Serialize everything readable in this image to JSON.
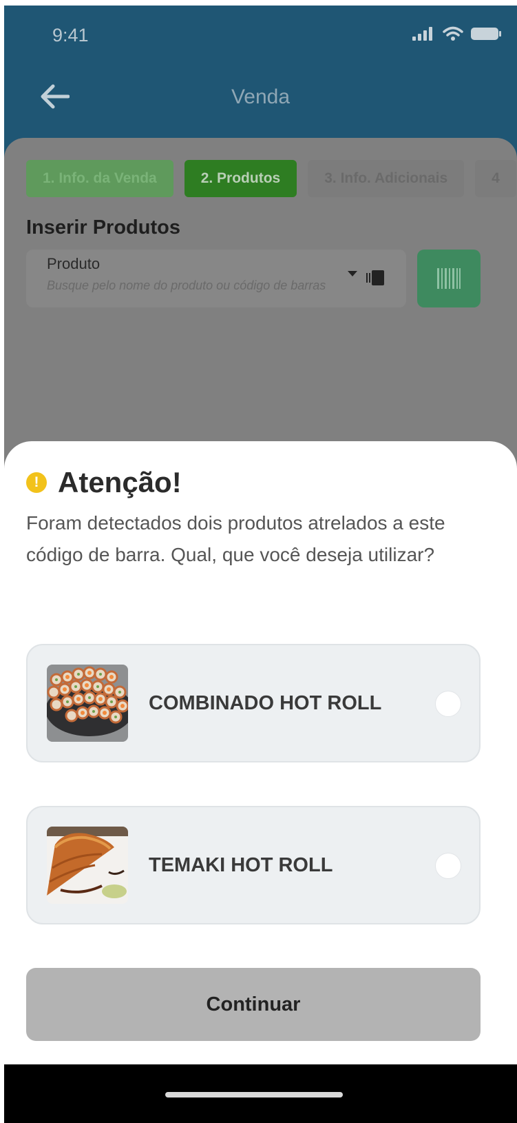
{
  "status_bar": {
    "time": "9:41"
  },
  "header": {
    "title": "Venda"
  },
  "steps": [
    {
      "label": "1. Info. da Venda"
    },
    {
      "label": "2. Produtos"
    },
    {
      "label": "3. Info. Adicionais"
    },
    {
      "label": "4"
    }
  ],
  "section": {
    "title": "Inserir Produtos"
  },
  "product_field": {
    "label": "Produto",
    "placeholder": "Busque pelo nome do produto ou código de barras"
  },
  "dialog": {
    "title": "Atenção!",
    "message": "Foram detectados dois produtos atrelados a este código de barra. Qual, que você deseja utilizar?",
    "options": [
      {
        "label": "COMBINADO HOT ROLL",
        "selected": false
      },
      {
        "label": "TEMAKI HOT ROLL",
        "selected": false
      }
    ],
    "continue_label": "Continuar"
  },
  "colors": {
    "header_bg": "#1f5674",
    "active_step": "#2e7d22",
    "warning": "#f2c21b",
    "option_bg": "#edf0f2",
    "continue_bg": "#b3b3b3"
  }
}
